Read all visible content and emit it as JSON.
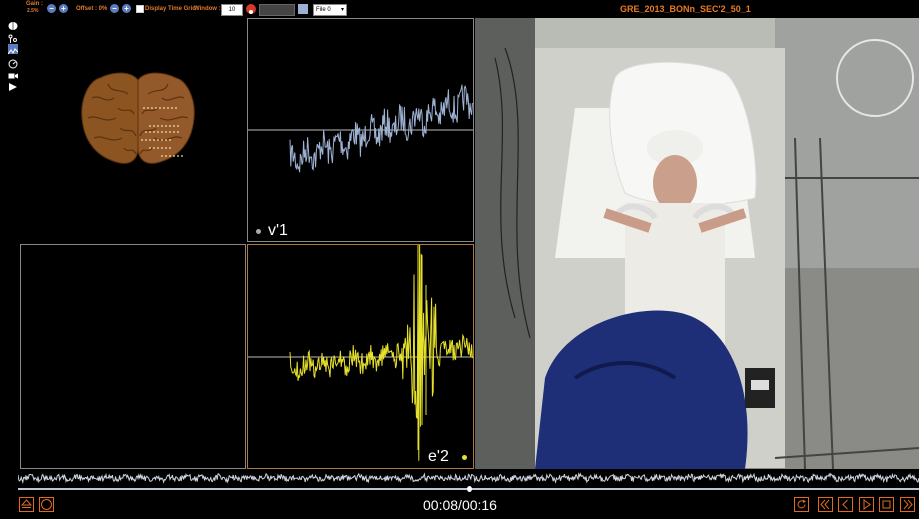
{
  "toolbar": {
    "gain_label": "Gain :",
    "gain_value": "2.5%",
    "gain_minus": "−",
    "gain_plus": "+",
    "offset_label": "Offset : 0%",
    "offset_minus": "−",
    "offset_plus": "+",
    "display_time_grid_label": "Display Time Grid",
    "window_label": "Window :",
    "window_value": "10",
    "file_select_value": "File 0"
  },
  "video_title": "GRE_2013_BONn_SEC'2_50_1",
  "sidebar_icons": [
    "brain-icon",
    "electrodes-icon",
    "signal-icon",
    "gauge-icon",
    "camera-icon",
    "flag-icon"
  ],
  "panels": [
    {
      "id": "brain",
      "label": ""
    },
    {
      "id": "v1",
      "label": "v'1",
      "color": "#9fb3d4"
    },
    {
      "id": "empty",
      "label": ""
    },
    {
      "id": "e2",
      "label": "e'2",
      "color": "#e6e12a"
    }
  ],
  "playback": {
    "current": "00:08",
    "separator": "/",
    "total": "00:16",
    "progress": 0.5
  },
  "colors": {
    "accent": "#e06b1e",
    "v1_trace": "#9fb3d4",
    "e2_trace": "#e6e12a"
  }
}
